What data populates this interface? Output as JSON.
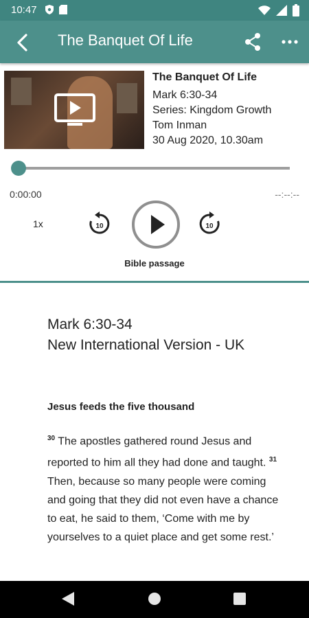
{
  "status_bar": {
    "time": "10:47"
  },
  "app_bar": {
    "title": "The Banquet Of Life",
    "icons": [
      "back-arrow-icon",
      "share-icon",
      "more-icon"
    ]
  },
  "sermon": {
    "title": "The Banquet Of Life",
    "reference": "Mark 6:30-34",
    "series": "Series: Kingdom Growth",
    "speaker": "Tom Inman",
    "date": "30 Aug 2020, 10.30am"
  },
  "player": {
    "current_time": "0:00:00",
    "end_time": "--:--:--",
    "speed": "1x",
    "rewind_seconds": "10",
    "forward_seconds": "10",
    "progress": 0
  },
  "tab_label": "Bible passage",
  "passage": {
    "reference": "Mark 6:30-34",
    "version": "New International Version - UK",
    "heading": "Jesus feeds the five thousand",
    "verse30": "30",
    "text1": "The apostles gathered round Jesus and reported to him all they had done and taught.",
    "verse31": "31",
    "text2": "Then, because so many people were coming and going that they did not even have a chance to eat, he said to them, ‘Come with me by yourselves to a quiet place and get some rest.’"
  },
  "colors": {
    "accent": "#4d908b",
    "statusbar": "#3f8580"
  }
}
